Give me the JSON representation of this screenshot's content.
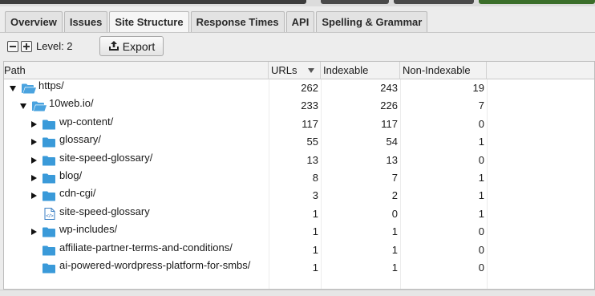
{
  "tabs": [
    {
      "label": "Overview",
      "active": false
    },
    {
      "label": "Issues",
      "active": false
    },
    {
      "label": "Site Structure",
      "active": true
    },
    {
      "label": "Response Times",
      "active": false
    },
    {
      "label": "API",
      "active": false
    },
    {
      "label": "Spelling & Grammar",
      "active": false
    }
  ],
  "toolbar": {
    "level_label": "Level: 2",
    "export_label": "Export",
    "collapse_icon": "collapse-all-icon",
    "expand_icon": "expand-all-icon"
  },
  "table": {
    "columns": [
      "Path",
      "URLs",
      "Indexable",
      "Non-Indexable"
    ],
    "sort_column": "URLs",
    "sort_direction": "descending",
    "rows": [
      {
        "path": "https/",
        "urls": "262",
        "indexable": "243",
        "non_indexable": "19",
        "depth": 0,
        "expander": "expanded",
        "icon": "folder-open-icon"
      },
      {
        "path": "10web.io/",
        "urls": "233",
        "indexable": "226",
        "non_indexable": "7",
        "depth": 1,
        "expander": "expanded",
        "icon": "folder-open-icon"
      },
      {
        "path": "wp-content/",
        "urls": "117",
        "indexable": "117",
        "non_indexable": "0",
        "depth": 2,
        "expander": "collapsed",
        "icon": "folder-icon"
      },
      {
        "path": "glossary/",
        "urls": "55",
        "indexable": "54",
        "non_indexable": "1",
        "depth": 2,
        "expander": "collapsed",
        "icon": "folder-icon"
      },
      {
        "path": "site-speed-glossary/",
        "urls": "13",
        "indexable": "13",
        "non_indexable": "0",
        "depth": 2,
        "expander": "collapsed",
        "icon": "folder-icon"
      },
      {
        "path": "blog/",
        "urls": "8",
        "indexable": "7",
        "non_indexable": "1",
        "depth": 2,
        "expander": "collapsed",
        "icon": "folder-icon"
      },
      {
        "path": "cdn-cgi/",
        "urls": "3",
        "indexable": "2",
        "non_indexable": "1",
        "depth": 2,
        "expander": "collapsed",
        "icon": "folder-icon"
      },
      {
        "path": "site-speed-glossary",
        "urls": "1",
        "indexable": "0",
        "non_indexable": "1",
        "depth": 2,
        "expander": "none",
        "icon": "html-file-icon"
      },
      {
        "path": "wp-includes/",
        "urls": "1",
        "indexable": "1",
        "non_indexable": "0",
        "depth": 2,
        "expander": "collapsed",
        "icon": "folder-icon"
      },
      {
        "path": "affiliate-partner-terms-and-conditions/",
        "urls": "1",
        "indexable": "1",
        "non_indexable": "0",
        "depth": 2,
        "expander": "none",
        "icon": "folder-icon"
      },
      {
        "path": "ai-powered-wordpress-platform-for-smbs/",
        "urls": "1",
        "indexable": "1",
        "non_indexable": "0",
        "depth": 2,
        "expander": "none",
        "icon": "folder-icon"
      }
    ]
  },
  "colors": {
    "folder": "#3a9ad9",
    "folder_open": "#4aa3df",
    "active_tab": "#f6f6f6",
    "accent_green": "#3b6e2a"
  }
}
